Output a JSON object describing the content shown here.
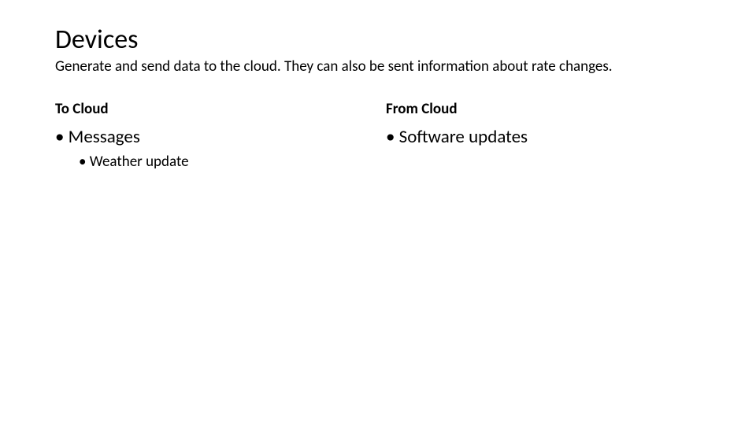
{
  "title": "Devices",
  "subtitle": "Generate and send data to the cloud. They can also be sent information about rate changes.",
  "left": {
    "heading": "To Cloud",
    "items": [
      {
        "label": "Messages",
        "sub": [
          {
            "label": "Weather update"
          }
        ]
      }
    ]
  },
  "right": {
    "heading": "From Cloud",
    "items": [
      {
        "label": "Software updates"
      }
    ]
  }
}
